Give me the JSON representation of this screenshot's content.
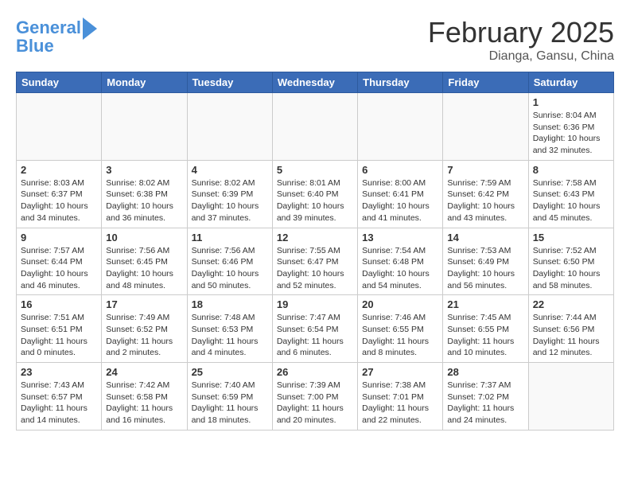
{
  "header": {
    "logo_line1": "General",
    "logo_line2": "Blue",
    "month_title": "February 2025",
    "location": "Dianga, Gansu, China"
  },
  "weekdays": [
    "Sunday",
    "Monday",
    "Tuesday",
    "Wednesday",
    "Thursday",
    "Friday",
    "Saturday"
  ],
  "weeks": [
    [
      {
        "day": "",
        "info": ""
      },
      {
        "day": "",
        "info": ""
      },
      {
        "day": "",
        "info": ""
      },
      {
        "day": "",
        "info": ""
      },
      {
        "day": "",
        "info": ""
      },
      {
        "day": "",
        "info": ""
      },
      {
        "day": "1",
        "info": "Sunrise: 8:04 AM\nSunset: 6:36 PM\nDaylight: 10 hours\nand 32 minutes."
      }
    ],
    [
      {
        "day": "2",
        "info": "Sunrise: 8:03 AM\nSunset: 6:37 PM\nDaylight: 10 hours\nand 34 minutes."
      },
      {
        "day": "3",
        "info": "Sunrise: 8:02 AM\nSunset: 6:38 PM\nDaylight: 10 hours\nand 36 minutes."
      },
      {
        "day": "4",
        "info": "Sunrise: 8:02 AM\nSunset: 6:39 PM\nDaylight: 10 hours\nand 37 minutes."
      },
      {
        "day": "5",
        "info": "Sunrise: 8:01 AM\nSunset: 6:40 PM\nDaylight: 10 hours\nand 39 minutes."
      },
      {
        "day": "6",
        "info": "Sunrise: 8:00 AM\nSunset: 6:41 PM\nDaylight: 10 hours\nand 41 minutes."
      },
      {
        "day": "7",
        "info": "Sunrise: 7:59 AM\nSunset: 6:42 PM\nDaylight: 10 hours\nand 43 minutes."
      },
      {
        "day": "8",
        "info": "Sunrise: 7:58 AM\nSunset: 6:43 PM\nDaylight: 10 hours\nand 45 minutes."
      }
    ],
    [
      {
        "day": "9",
        "info": "Sunrise: 7:57 AM\nSunset: 6:44 PM\nDaylight: 10 hours\nand 46 minutes."
      },
      {
        "day": "10",
        "info": "Sunrise: 7:56 AM\nSunset: 6:45 PM\nDaylight: 10 hours\nand 48 minutes."
      },
      {
        "day": "11",
        "info": "Sunrise: 7:56 AM\nSunset: 6:46 PM\nDaylight: 10 hours\nand 50 minutes."
      },
      {
        "day": "12",
        "info": "Sunrise: 7:55 AM\nSunset: 6:47 PM\nDaylight: 10 hours\nand 52 minutes."
      },
      {
        "day": "13",
        "info": "Sunrise: 7:54 AM\nSunset: 6:48 PM\nDaylight: 10 hours\nand 54 minutes."
      },
      {
        "day": "14",
        "info": "Sunrise: 7:53 AM\nSunset: 6:49 PM\nDaylight: 10 hours\nand 56 minutes."
      },
      {
        "day": "15",
        "info": "Sunrise: 7:52 AM\nSunset: 6:50 PM\nDaylight: 10 hours\nand 58 minutes."
      }
    ],
    [
      {
        "day": "16",
        "info": "Sunrise: 7:51 AM\nSunset: 6:51 PM\nDaylight: 11 hours\nand 0 minutes."
      },
      {
        "day": "17",
        "info": "Sunrise: 7:49 AM\nSunset: 6:52 PM\nDaylight: 11 hours\nand 2 minutes."
      },
      {
        "day": "18",
        "info": "Sunrise: 7:48 AM\nSunset: 6:53 PM\nDaylight: 11 hours\nand 4 minutes."
      },
      {
        "day": "19",
        "info": "Sunrise: 7:47 AM\nSunset: 6:54 PM\nDaylight: 11 hours\nand 6 minutes."
      },
      {
        "day": "20",
        "info": "Sunrise: 7:46 AM\nSunset: 6:55 PM\nDaylight: 11 hours\nand 8 minutes."
      },
      {
        "day": "21",
        "info": "Sunrise: 7:45 AM\nSunset: 6:55 PM\nDaylight: 11 hours\nand 10 minutes."
      },
      {
        "day": "22",
        "info": "Sunrise: 7:44 AM\nSunset: 6:56 PM\nDaylight: 11 hours\nand 12 minutes."
      }
    ],
    [
      {
        "day": "23",
        "info": "Sunrise: 7:43 AM\nSunset: 6:57 PM\nDaylight: 11 hours\nand 14 minutes."
      },
      {
        "day": "24",
        "info": "Sunrise: 7:42 AM\nSunset: 6:58 PM\nDaylight: 11 hours\nand 16 minutes."
      },
      {
        "day": "25",
        "info": "Sunrise: 7:40 AM\nSunset: 6:59 PM\nDaylight: 11 hours\nand 18 minutes."
      },
      {
        "day": "26",
        "info": "Sunrise: 7:39 AM\nSunset: 7:00 PM\nDaylight: 11 hours\nand 20 minutes."
      },
      {
        "day": "27",
        "info": "Sunrise: 7:38 AM\nSunset: 7:01 PM\nDaylight: 11 hours\nand 22 minutes."
      },
      {
        "day": "28",
        "info": "Sunrise: 7:37 AM\nSunset: 7:02 PM\nDaylight: 11 hours\nand 24 minutes."
      },
      {
        "day": "",
        "info": ""
      }
    ]
  ]
}
